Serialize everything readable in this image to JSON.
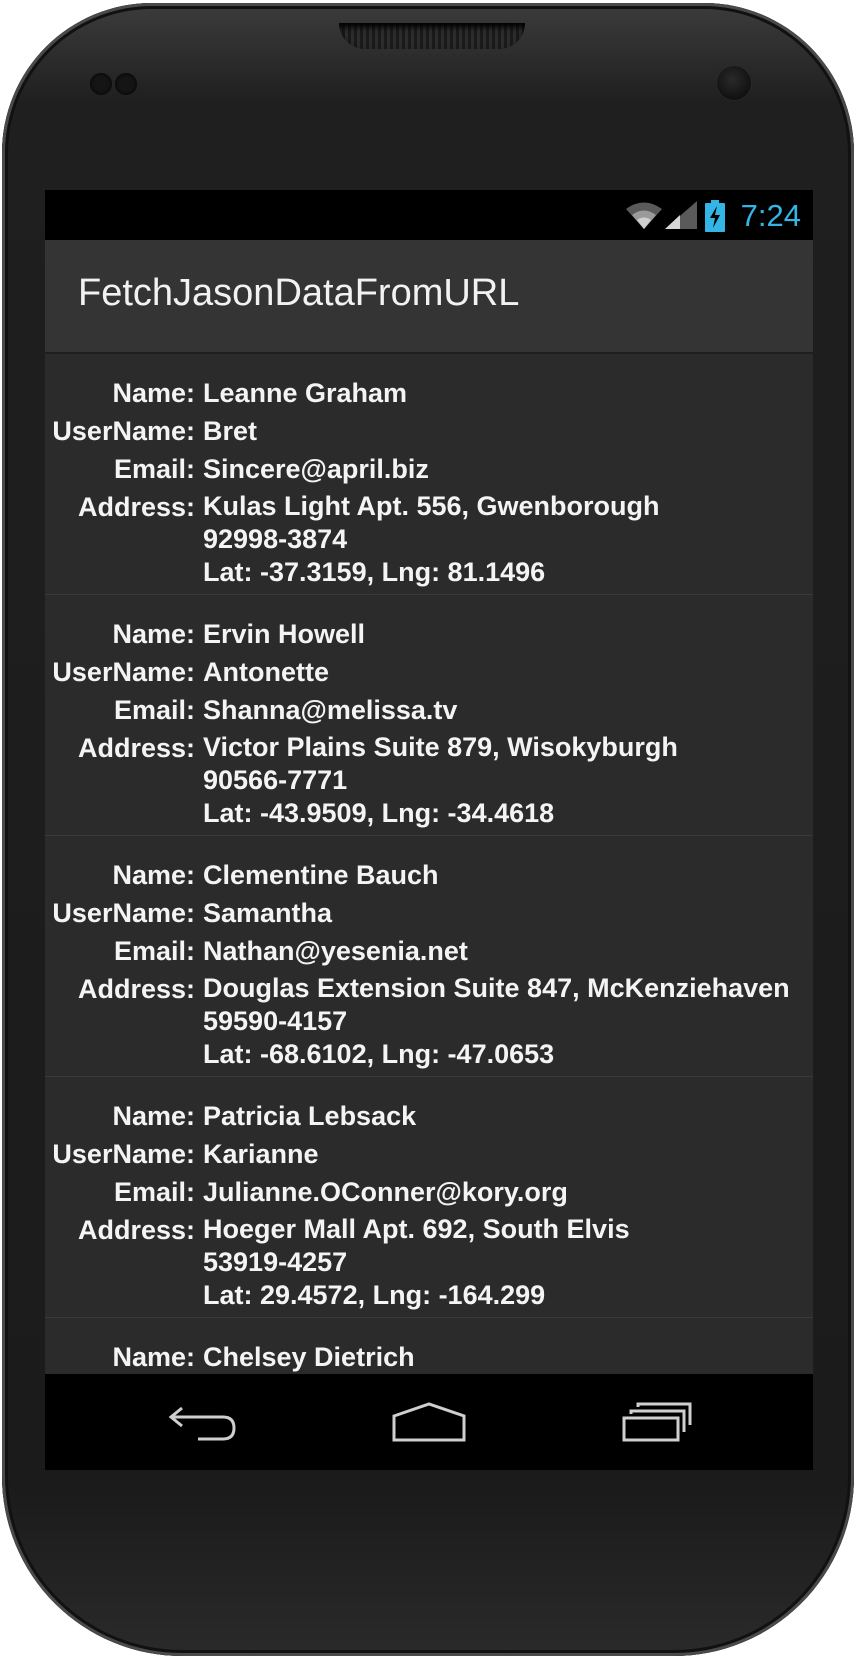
{
  "status_bar": {
    "time": "7:24",
    "icons": [
      "wifi-icon",
      "signal-icon",
      "battery-charging-icon"
    ],
    "accent_color": "#33b5e5"
  },
  "action_bar": {
    "title": "FetchJasonDataFromURL"
  },
  "labels": {
    "name": "Name:",
    "username": "UserName:",
    "email": "Email:",
    "address": "Address:"
  },
  "users": [
    {
      "name": "Leanne Graham",
      "username": "Bret",
      "email": "Sincere@april.biz",
      "address_line1": "Kulas Light Apt. 556, Gwenborough",
      "address_line2": "92998-3874",
      "address_line3": "Lat: -37.3159, Lng: 81.1496"
    },
    {
      "name": "Ervin Howell",
      "username": "Antonette",
      "email": "Shanna@melissa.tv",
      "address_line1": "Victor Plains Suite 879, Wisokyburgh",
      "address_line2": "90566-7771",
      "address_line3": "Lat: -43.9509, Lng: -34.4618"
    },
    {
      "name": "Clementine Bauch",
      "username": "Samantha",
      "email": "Nathan@yesenia.net",
      "address_line1": "Douglas Extension Suite 847, McKenziehaven",
      "address_line2": "59590-4157",
      "address_line3": "Lat: -68.6102, Lng: -47.0653"
    },
    {
      "name": "Patricia Lebsack",
      "username": "Karianne",
      "email": "Julianne.OConner@kory.org",
      "address_line1": "Hoeger Mall Apt. 692, South Elvis",
      "address_line2": "53919-4257",
      "address_line3": "Lat: 29.4572, Lng: -164.299"
    },
    {
      "name": "Chelsey Dietrich"
    }
  ],
  "nav_bar": {
    "buttons": [
      "back-icon",
      "home-icon",
      "recent-apps-icon"
    ]
  }
}
